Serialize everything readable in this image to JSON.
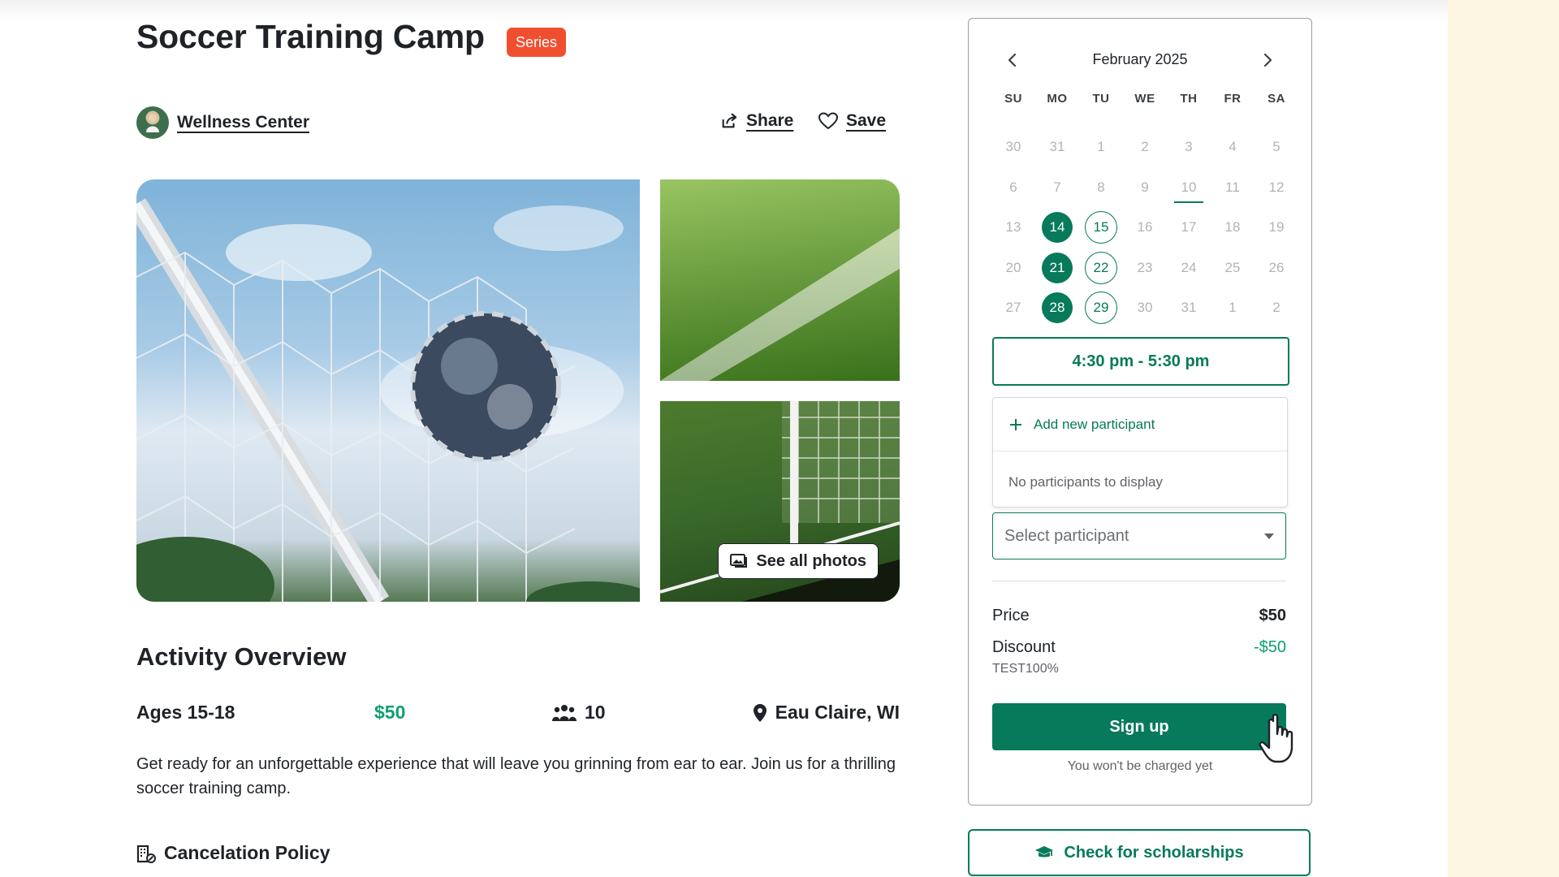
{
  "header": {
    "title": "Soccer Training Camp",
    "badge": "Series",
    "organizer": "Wellness Center",
    "share_label": "Share",
    "save_label": "Save"
  },
  "gallery": {
    "see_all_label": "See all photos"
  },
  "overview": {
    "title": "Activity Overview",
    "ages": "Ages 15-18",
    "price": "$50",
    "capacity": "10",
    "location": "Eau Claire, WI",
    "description": "Get ready for an unforgettable experience that will leave you grinning from ear to ear. Join us for a thrilling soccer training camp.",
    "cancelation_policy_label": "Cancelation Policy"
  },
  "calendar": {
    "month_label": "February 2025",
    "weekdays": [
      "SU",
      "MO",
      "TU",
      "WE",
      "TH",
      "FR",
      "SA"
    ],
    "weeks": [
      [
        {
          "d": "30"
        },
        {
          "d": "31"
        },
        {
          "d": "1"
        },
        {
          "d": "2"
        },
        {
          "d": "3"
        },
        {
          "d": "4"
        },
        {
          "d": "5"
        }
      ],
      [
        {
          "d": "6"
        },
        {
          "d": "7"
        },
        {
          "d": "8"
        },
        {
          "d": "9"
        },
        {
          "d": "10",
          "state": "today"
        },
        {
          "d": "11"
        },
        {
          "d": "12"
        }
      ],
      [
        {
          "d": "13"
        },
        {
          "d": "14",
          "state": "selected"
        },
        {
          "d": "15",
          "state": "available"
        },
        {
          "d": "16"
        },
        {
          "d": "17"
        },
        {
          "d": "18"
        },
        {
          "d": "19"
        }
      ],
      [
        {
          "d": "20"
        },
        {
          "d": "21",
          "state": "selected"
        },
        {
          "d": "22",
          "state": "available"
        },
        {
          "d": "23"
        },
        {
          "d": "24"
        },
        {
          "d": "25"
        },
        {
          "d": "26"
        }
      ],
      [
        {
          "d": "27"
        },
        {
          "d": "28",
          "state": "selected"
        },
        {
          "d": "29",
          "state": "available"
        },
        {
          "d": "30"
        },
        {
          "d": "31"
        },
        {
          "d": "1"
        },
        {
          "d": "2"
        }
      ]
    ]
  },
  "booking": {
    "time_slot": "4:30 pm - 5:30 pm",
    "add_participant_label": "Add new participant",
    "no_participants_text": "No participants to display",
    "select_placeholder": "Select participant",
    "price_label": "Price",
    "price_value": "$50",
    "discount_label": "Discount",
    "discount_value": "-$50",
    "discount_code": "TEST100%",
    "signup_label": "Sign up",
    "charge_note": "You won't be charged yet",
    "scholarships_label": "Check for scholarships"
  },
  "colors": {
    "primary": "#067a5b",
    "accent_green": "#0e9f6e",
    "badge_red": "#f04f2f",
    "side_panel": "#fdf6e3"
  }
}
